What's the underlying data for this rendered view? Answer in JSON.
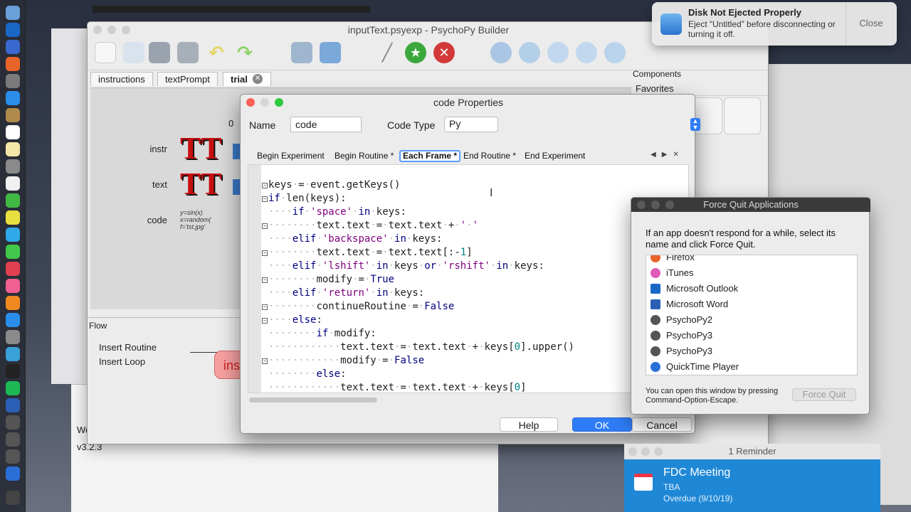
{
  "builder": {
    "title": "inputText.psyexp - PsychoPy Builder",
    "routine_tabs": [
      {
        "label": "instructions"
      },
      {
        "label": "textPrompt"
      },
      {
        "label": "trial"
      }
    ],
    "timeline_zero": "0",
    "components": [
      {
        "label": "instr"
      },
      {
        "label": "text"
      },
      {
        "label": "code"
      }
    ],
    "code_icon_text": "y=sin(x) x=random( f='tst.jpg'",
    "tt_glyph": "TT",
    "flow": {
      "label": "Flow",
      "insert_routine": "Insert Routine",
      "insert_loop": "Insert Loop",
      "routine_pill": "ins"
    },
    "components_panel": {
      "title": "Components",
      "favorites": "Favorites"
    }
  },
  "code_properties": {
    "title": "code Properties",
    "name_label": "Name",
    "name_value": "code",
    "type_label": "Code Type",
    "type_value": "Py",
    "tabs": [
      {
        "label": "Begin Experiment"
      },
      {
        "label": "Begin Routine *"
      },
      {
        "label": "Each Frame *"
      },
      {
        "label": "End Routine *"
      },
      {
        "label": "End Experiment"
      }
    ],
    "active_tab": "Each Frame *",
    "buttons": {
      "help": "Help",
      "ok": "OK",
      "cancel": "Cancel"
    }
  },
  "force_quit": {
    "title": "Force Quit Applications",
    "description": "If an app doesn't respond for a while, select its name and click Force Quit.",
    "apps": [
      {
        "name": "Firefox",
        "icon": "firefox-icon",
        "color": "#e8642a"
      },
      {
        "name": "iTunes",
        "icon": "itunes-icon",
        "color": "#e05bb8"
      },
      {
        "name": "Microsoft Outlook",
        "icon": "outlook-icon",
        "color": "#1a67c6"
      },
      {
        "name": "Microsoft Word",
        "icon": "word-icon",
        "color": "#2b5fb5"
      },
      {
        "name": "PsychoPy2",
        "icon": "psychopy-icon",
        "color": "#555555"
      },
      {
        "name": "PsychoPy3",
        "icon": "psychopy-icon",
        "color": "#555555"
      },
      {
        "name": "PsychoPy3",
        "icon": "psychopy-icon",
        "color": "#555555"
      },
      {
        "name": "QuickTime Player",
        "icon": "quicktime-icon",
        "color": "#2a6fd6"
      }
    ],
    "footer": "You can open this window by pressing Command-Option-Escape.",
    "button": "Force Quit"
  },
  "notification": {
    "title": "Disk Not Ejected Properly",
    "body": "Eject “Untitled” before disconnecting or turning it off.",
    "action": "Close"
  },
  "reminder": {
    "window_title": "1 Reminder",
    "title": "FDC Meeting",
    "subtitle": "TBA",
    "due": "Overdue (9/10/19)"
  },
  "shell": {
    "line1": "We",
    "line2": "v3.2.3"
  },
  "colors": {
    "accent": "#2f7df6",
    "code_keyword": "#00007f",
    "code_string": "#7f007f",
    "code_number": "#007f7f",
    "reminder_bg": "#1f88d6"
  }
}
